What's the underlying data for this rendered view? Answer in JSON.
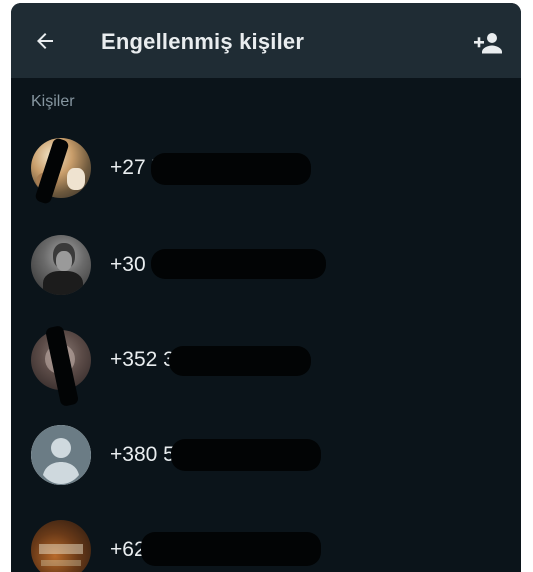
{
  "header": {
    "title": "Engellenmiş kişiler",
    "back_icon": "arrow-left-icon",
    "add_icon": "person-add-icon"
  },
  "section": {
    "label": "Kişiler"
  },
  "contacts": [
    {
      "phone": "+27 7",
      "avatar": "photo-avatar"
    },
    {
      "phone": "+30 6",
      "avatar": "photo-avatar"
    },
    {
      "phone": "+352 3",
      "avatar": "photo-avatar"
    },
    {
      "phone": "+380 5",
      "avatar": "default-person-avatar"
    },
    {
      "phone": "+62",
      "avatar": "photo-avatar"
    }
  ],
  "colors": {
    "background": "#0b141a",
    "appbar": "#1f2c34",
    "primary_text": "#e9edef",
    "secondary_text": "#8696a0"
  }
}
